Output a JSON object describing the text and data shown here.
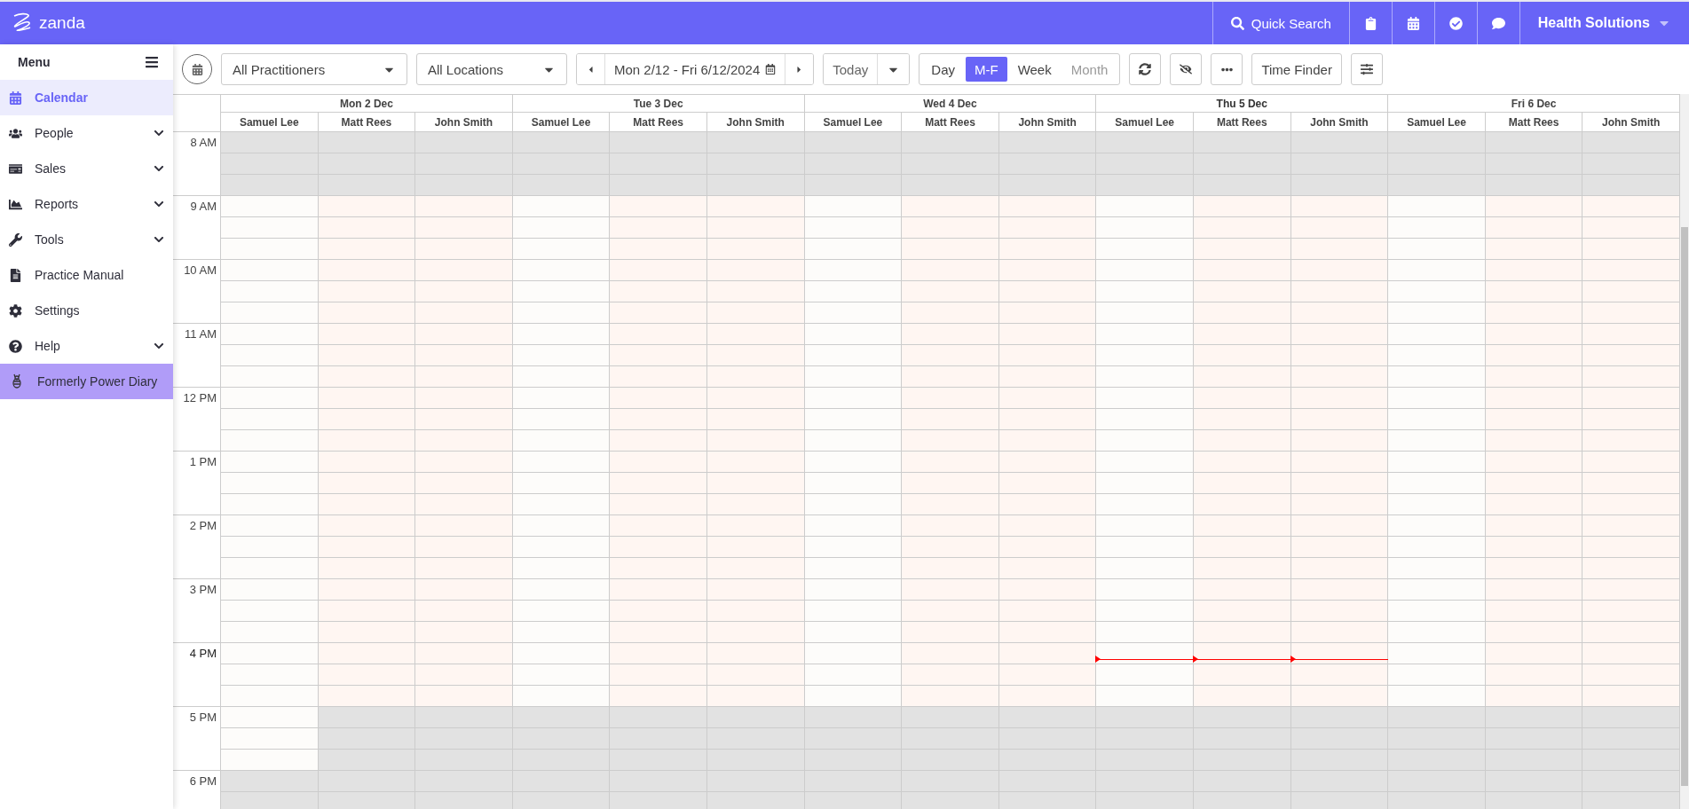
{
  "topbar": {
    "logo": "zanda",
    "search": "Quick Search",
    "account": "Health Solutions"
  },
  "sidebar": {
    "title": "Menu",
    "items": [
      {
        "label": "Calendar",
        "expandable": false,
        "selected": true,
        "kind": "nav"
      },
      {
        "label": "People",
        "expandable": true,
        "selected": false,
        "kind": "nav"
      },
      {
        "label": "Sales",
        "expandable": true,
        "selected": false,
        "kind": "nav"
      },
      {
        "label": "Reports",
        "expandable": true,
        "selected": false,
        "kind": "nav"
      },
      {
        "label": "Tools",
        "expandable": true,
        "selected": false,
        "kind": "nav"
      },
      {
        "label": "Practice Manual",
        "expandable": false,
        "selected": false,
        "kind": "nav"
      },
      {
        "label": "Settings",
        "expandable": false,
        "selected": false,
        "kind": "nav"
      },
      {
        "label": "Help",
        "expandable": true,
        "selected": false,
        "kind": "nav"
      },
      {
        "label": "Formerly Power Diary",
        "expandable": false,
        "selected": false,
        "kind": "promo"
      }
    ]
  },
  "toolbar": {
    "practitioners": "All Practitioners",
    "locations": "All Locations",
    "date_range": "Mon 2/12 - Fri 6/12/2024",
    "today": "Today",
    "views": [
      {
        "label": "Day",
        "selected": false,
        "disabled": false
      },
      {
        "label": "M-F",
        "selected": true,
        "disabled": false
      },
      {
        "label": "Week",
        "selected": false,
        "disabled": false
      },
      {
        "label": "Month",
        "selected": false,
        "disabled": true
      }
    ],
    "time_finder": "Time Finder"
  },
  "hours": [
    {
      "label": "8 AM",
      "now": false
    },
    {
      "label": "9 AM",
      "now": false
    },
    {
      "label": "10 AM",
      "now": false
    },
    {
      "label": "11 AM",
      "now": false
    },
    {
      "label": "12 PM",
      "now": false
    },
    {
      "label": "1 PM",
      "now": false
    },
    {
      "label": "2 PM",
      "now": false
    },
    {
      "label": "3 PM",
      "now": false
    },
    {
      "label": "4 PM",
      "now": true
    },
    {
      "label": "5 PM",
      "now": false
    },
    {
      "label": "6 PM",
      "now": false
    }
  ],
  "days": [
    {
      "label": "Mon 2 Dec",
      "today": false,
      "practitioners": [
        {
          "name": "Samuel Lee",
          "color": "#fdfcfa",
          "available": [
            false,
            true,
            true,
            true,
            true,
            true,
            true,
            true,
            true,
            true,
            false
          ]
        },
        {
          "name": "Matt Rees",
          "color": "#fff6f2",
          "available": [
            false,
            true,
            true,
            true,
            true,
            true,
            true,
            true,
            true,
            false,
            false
          ]
        },
        {
          "name": "John Smith",
          "color": "#fff6f2",
          "available": [
            false,
            true,
            true,
            true,
            true,
            true,
            true,
            true,
            true,
            false,
            false
          ]
        }
      ]
    },
    {
      "label": "Tue 3 Dec",
      "today": false,
      "practitioners": [
        {
          "name": "Samuel Lee",
          "color": "#fdfcfa",
          "available": [
            false,
            true,
            true,
            true,
            true,
            true,
            true,
            true,
            true,
            false,
            false
          ]
        },
        {
          "name": "Matt Rees",
          "color": "#fff6f2",
          "available": [
            false,
            true,
            true,
            true,
            true,
            true,
            true,
            true,
            true,
            false,
            false
          ]
        },
        {
          "name": "John Smith",
          "color": "#fff6f2",
          "available": [
            false,
            true,
            true,
            true,
            true,
            true,
            true,
            true,
            true,
            false,
            false
          ]
        }
      ]
    },
    {
      "label": "Wed 4 Dec",
      "today": false,
      "practitioners": [
        {
          "name": "Samuel Lee",
          "color": "#fdfcfa",
          "available": [
            false,
            true,
            true,
            true,
            true,
            true,
            true,
            true,
            true,
            false,
            false
          ]
        },
        {
          "name": "Matt Rees",
          "color": "#fff6f2",
          "available": [
            false,
            true,
            true,
            true,
            true,
            true,
            true,
            true,
            true,
            false,
            false
          ]
        },
        {
          "name": "John Smith",
          "color": "#fff6f2",
          "available": [
            false,
            true,
            true,
            true,
            true,
            true,
            true,
            true,
            true,
            false,
            false
          ]
        }
      ]
    },
    {
      "label": "Thu 5 Dec",
      "today": true,
      "practitioners": [
        {
          "name": "Samuel Lee",
          "color": "#fdfcfa",
          "available": [
            false,
            true,
            true,
            true,
            true,
            true,
            true,
            true,
            true,
            false,
            false
          ]
        },
        {
          "name": "Matt Rees",
          "color": "#fff6f2",
          "available": [
            false,
            true,
            true,
            true,
            true,
            true,
            true,
            true,
            true,
            false,
            false
          ]
        },
        {
          "name": "John Smith",
          "color": "#fff6f2",
          "available": [
            false,
            true,
            true,
            true,
            true,
            true,
            true,
            true,
            true,
            false,
            false
          ]
        }
      ]
    },
    {
      "label": "Fri 6 Dec",
      "today": false,
      "practitioners": [
        {
          "name": "Samuel Lee",
          "color": "#fdfcfa",
          "available": [
            false,
            true,
            true,
            true,
            true,
            true,
            true,
            true,
            true,
            false,
            false
          ]
        },
        {
          "name": "Matt Rees",
          "color": "#fff6f2",
          "available": [
            false,
            true,
            true,
            true,
            true,
            true,
            true,
            true,
            true,
            false,
            false
          ]
        },
        {
          "name": "John Smith",
          "color": "#fff6f2",
          "available": [
            false,
            true,
            true,
            true,
            true,
            true,
            true,
            true,
            true,
            false,
            false
          ]
        }
      ]
    }
  ]
}
